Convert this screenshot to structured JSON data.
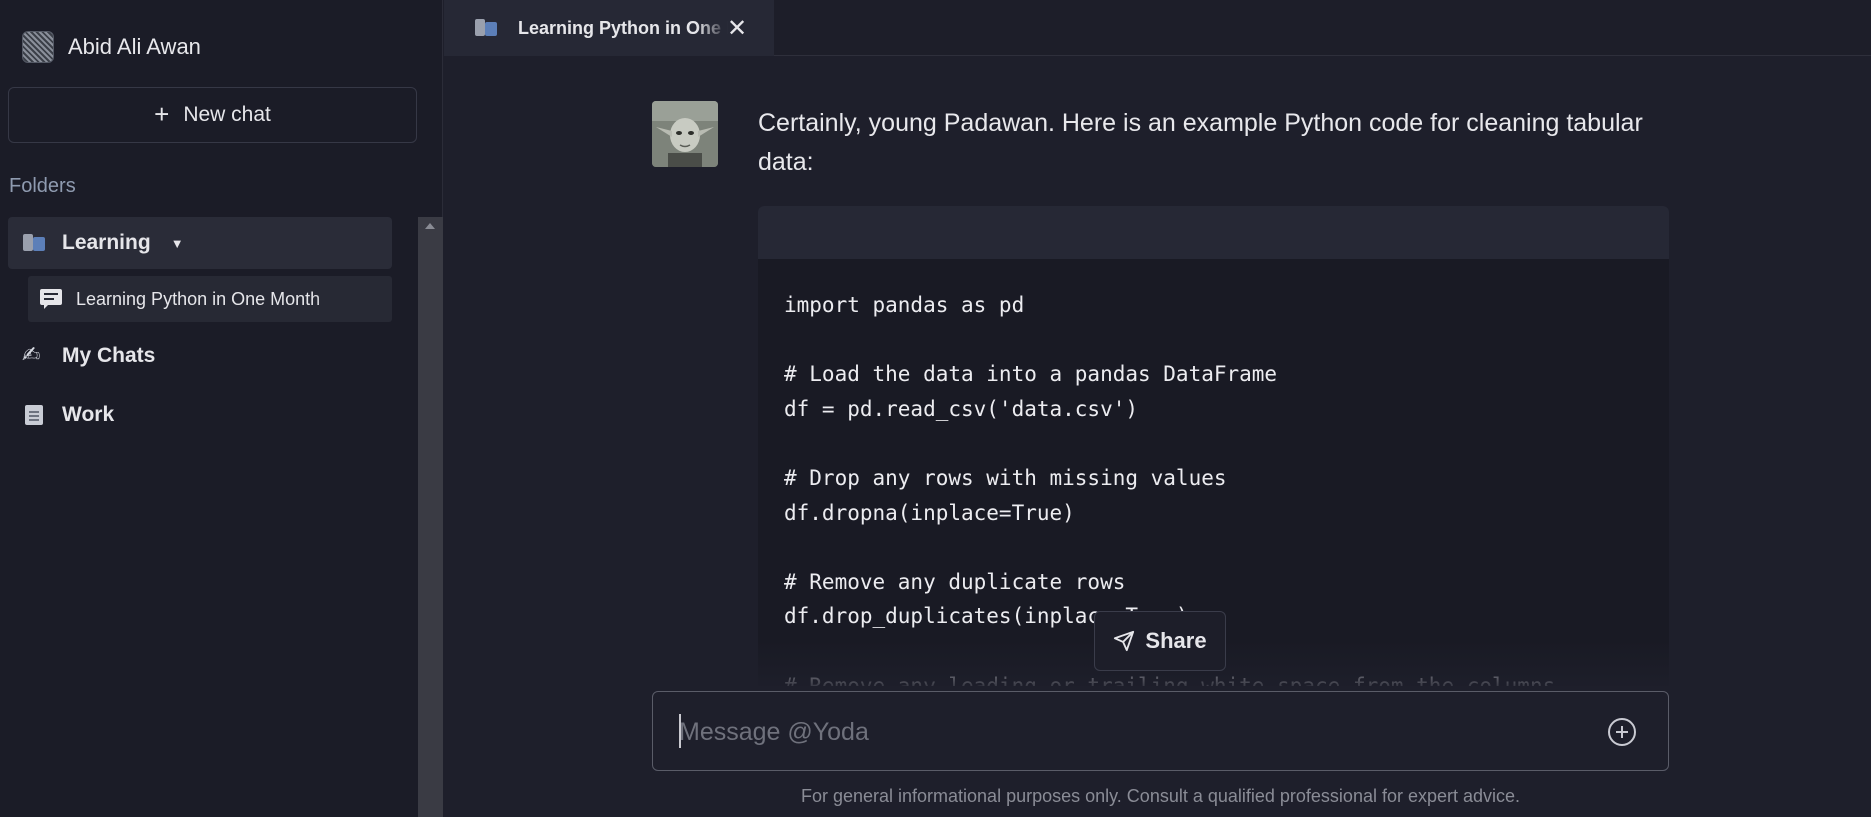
{
  "sidebar": {
    "user_name": "Abid Ali Awan",
    "new_chat_label": "New chat",
    "folders_label": "Folders",
    "folders": [
      {
        "label": "Learning",
        "icon": "books-icon",
        "expanded": true
      },
      {
        "label": "My Chats",
        "icon": "writing-hand-icon"
      },
      {
        "label": "Work",
        "icon": "office-building-icon"
      }
    ],
    "chat_items": [
      {
        "label": "Learning Python in One Month"
      }
    ]
  },
  "tab": {
    "title": "Learning Python in One Month",
    "icon": "books-icon"
  },
  "message": {
    "text": "Certainly, young Padawan. Here is an example Python code for cleaning tabular data:",
    "code_lines": [
      "import pandas as pd",
      "",
      "# Load the data into a pandas DataFrame",
      "df = pd.read_csv('data.csv')",
      "",
      "# Drop any rows with missing values",
      "df.dropna(inplace=True)",
      "",
      "# Remove any duplicate rows",
      "df.drop_duplicates(inplace=True)",
      "",
      "# Remove any leading or trailing white space from the columns"
    ]
  },
  "share_label": "Share",
  "composer": {
    "placeholder": "Message @Yoda"
  },
  "disclaimer": "For general informational purposes only. Consult a qualified professional for expert advice.",
  "colors": {
    "background": "#1e1f2b",
    "sidebar": "#1b1c27",
    "active_item": "#2a2c38",
    "code_bg": "#191a24"
  }
}
